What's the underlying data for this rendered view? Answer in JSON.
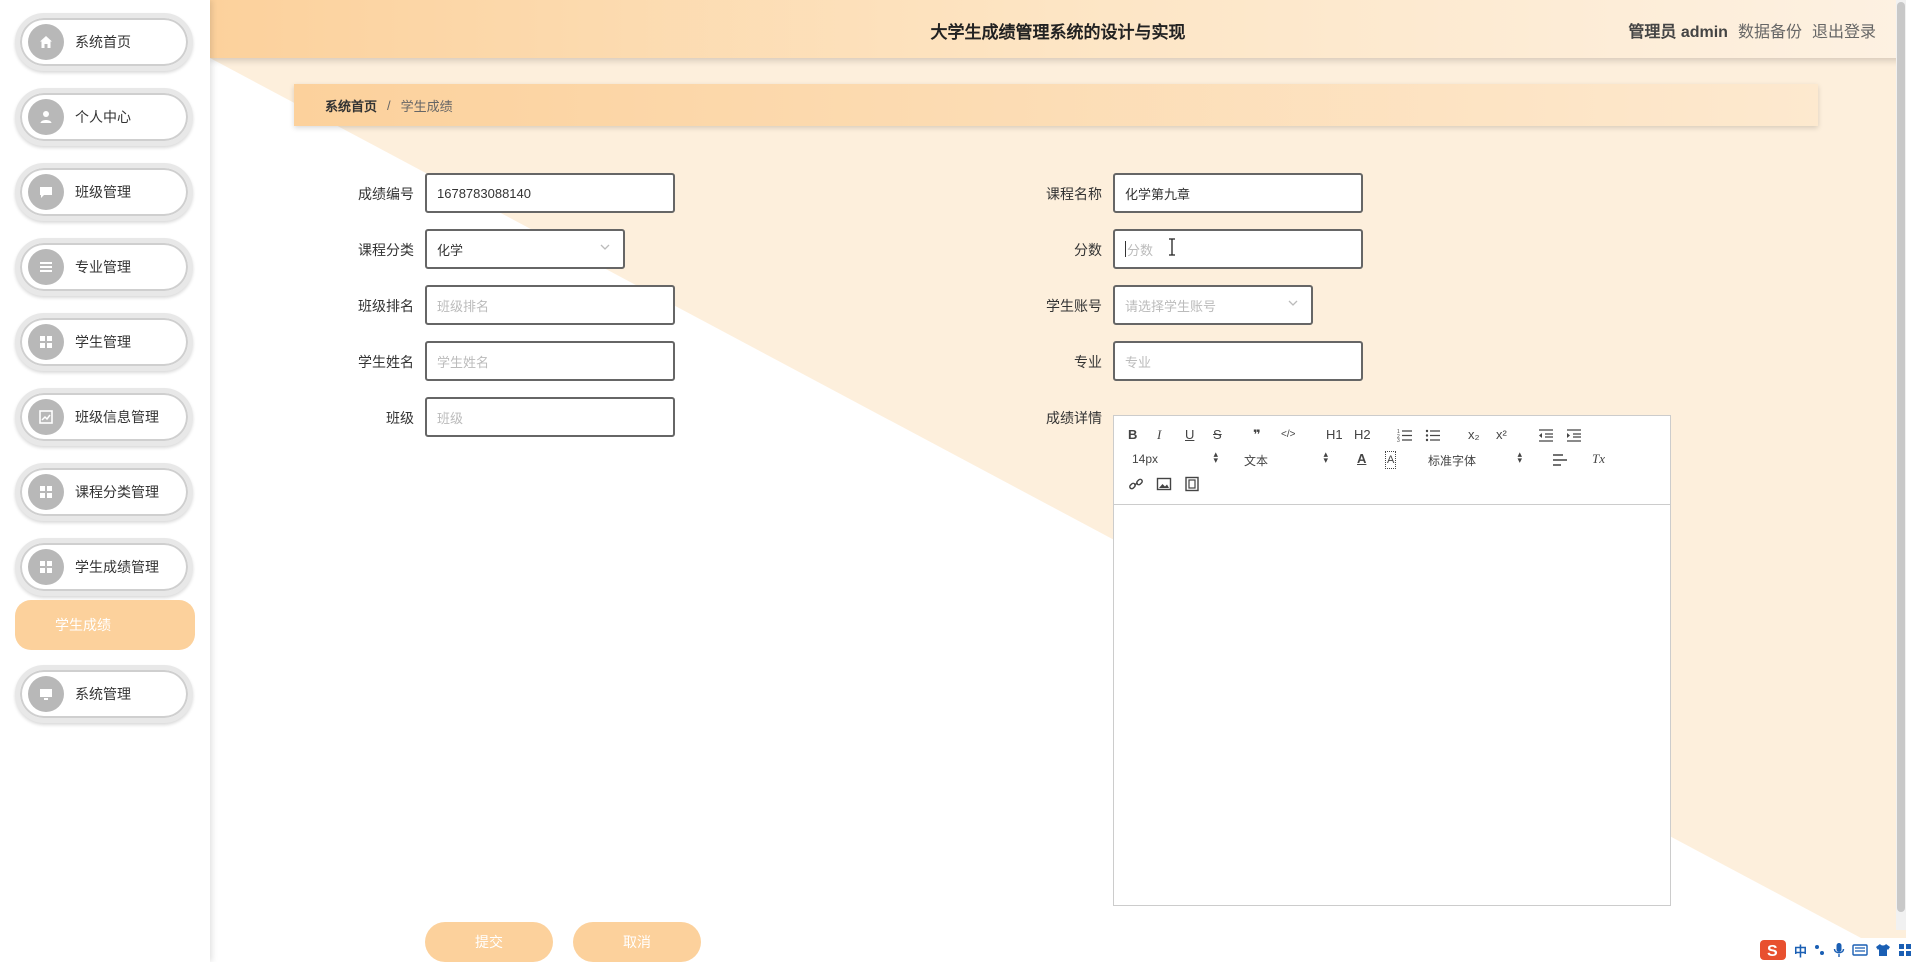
{
  "app_title": "大学生成绩管理系统的设计与实现",
  "header": {
    "admin_label": "管理员 admin",
    "backup_label": "数据备份",
    "logout_label": "退出登录"
  },
  "sidebar": {
    "items": [
      {
        "label": "系统首页",
        "icon": "home-icon"
      },
      {
        "label": "个人中心",
        "icon": "user-icon"
      },
      {
        "label": "班级管理",
        "icon": "chat-icon"
      },
      {
        "label": "专业管理",
        "icon": "list-icon"
      },
      {
        "label": "学生管理",
        "icon": "grid-icon"
      },
      {
        "label": "班级信息管理",
        "icon": "chart-icon"
      },
      {
        "label": "课程分类管理",
        "icon": "grid-icon"
      },
      {
        "label": "学生成绩管理",
        "icon": "grid-icon"
      },
      {
        "label": "系统管理",
        "icon": "monitor-icon"
      }
    ],
    "active_sub": "学生成绩"
  },
  "breadcrumb": {
    "home": "系统首页",
    "separator": "/",
    "current": "学生成绩"
  },
  "form": {
    "score_no": {
      "label": "成绩编号",
      "value": "1678783088140"
    },
    "course_name": {
      "label": "课程名称",
      "value": "化学第九章"
    },
    "course_category": {
      "label": "课程分类",
      "value": "化学"
    },
    "score": {
      "label": "分数",
      "placeholder": "分数"
    },
    "class_rank": {
      "label": "班级排名",
      "placeholder": "班级排名"
    },
    "student_account": {
      "label": "学生账号",
      "placeholder": "请选择学生账号"
    },
    "student_name": {
      "label": "学生姓名",
      "placeholder": "学生姓名"
    },
    "major": {
      "label": "专业",
      "placeholder": "专业"
    },
    "class_name": {
      "label": "班级",
      "placeholder": "班级"
    },
    "detail": {
      "label": "成绩详情"
    }
  },
  "editor": {
    "font_size": "14px",
    "header_format": "文本",
    "font_family": "标准字体",
    "buttons": {
      "bold": "B",
      "italic": "I",
      "underline": "U",
      "strike": "S",
      "blockquote": "❞",
      "code": "</>",
      "h1": "H1",
      "h2": "H2",
      "sub": "x₂",
      "sup": "x²",
      "color": "A",
      "bg": "A",
      "clean": "Tx"
    }
  },
  "buttons": {
    "submit": "提交",
    "cancel": "取消"
  },
  "ime": {
    "lang": "中"
  },
  "colors": {
    "accent": "#fcd19c",
    "accent_light": "#fdefdc"
  }
}
